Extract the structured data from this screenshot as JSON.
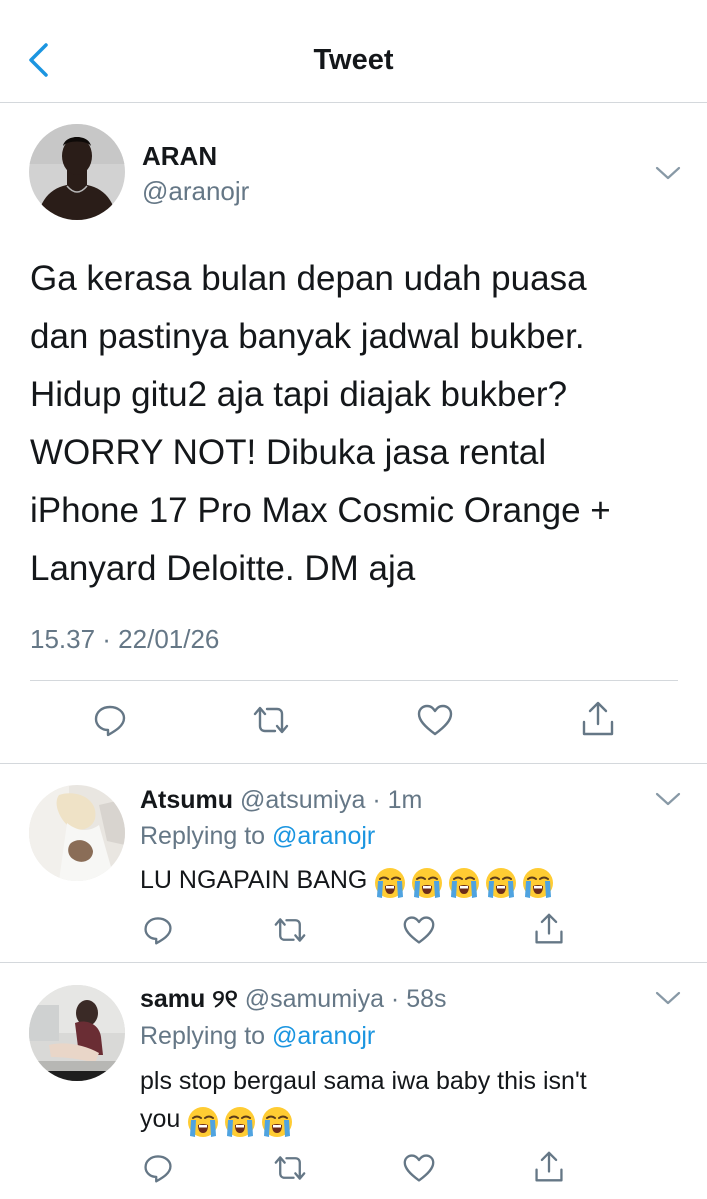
{
  "header": {
    "title": "Tweet"
  },
  "main_tweet": {
    "name": "ARAN",
    "handle": "@aranojr",
    "lines": [
      "Ga kerasa bulan depan udah puasa",
      "dan pastinya banyak jadwal bukber.",
      "Hidup gitu2 aja tapi diajak bukber?",
      "WORRY NOT! Dibuka jasa rental",
      "iPhone 17 Pro Max Cosmic Orange +",
      "Lanyard Deloitte. DM aja"
    ],
    "timestamp": "15.37 · 22/01/26"
  },
  "replies": [
    {
      "name": "Atsumu",
      "handle": "@atsumiya · 1m",
      "replying_prefix": "Replying to",
      "replying_to": "@aranojr",
      "text_lines": [
        "LU NGAPAIN BANG"
      ],
      "emoji": [
        "loudly-crying-face",
        "loudly-crying-face",
        "loudly-crying-face",
        "loudly-crying-face",
        "loudly-crying-face"
      ]
    },
    {
      "name": "samu ୨୧",
      "handle": "@samumiya · 58s",
      "replying_prefix": "Replying to",
      "replying_to": "@aranojr",
      "text_lines": [
        "pls stop bergaul sama iwa baby this isn't",
        "you"
      ],
      "emoji": [
        "loudly-crying-face",
        "loudly-crying-face",
        "loudly-crying-face"
      ]
    }
  ],
  "colors": {
    "accent": "#1b95e0",
    "secondary_text": "#657786",
    "icon": "#657786",
    "divider": "#d4d8dc"
  }
}
